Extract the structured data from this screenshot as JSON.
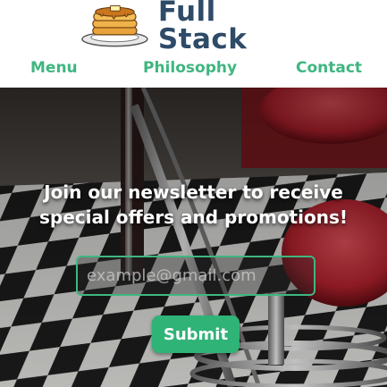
{
  "header": {
    "brand_name": "Full Stack",
    "logo_icon": "pancake-stack-icon",
    "nav": {
      "menu": "Menu",
      "philosophy": "Philosophy",
      "contact": "Contact"
    }
  },
  "hero": {
    "headline_line1": "Join our newsletter to receive",
    "headline_line2": "special offers and promotions!",
    "email_placeholder": "example@gmail.com",
    "email_value": "",
    "submit_label": "Submit"
  },
  "colors": {
    "brand_text": "#2e4b68",
    "accent_green": "#3fb680",
    "button_green": "#2fb377"
  }
}
